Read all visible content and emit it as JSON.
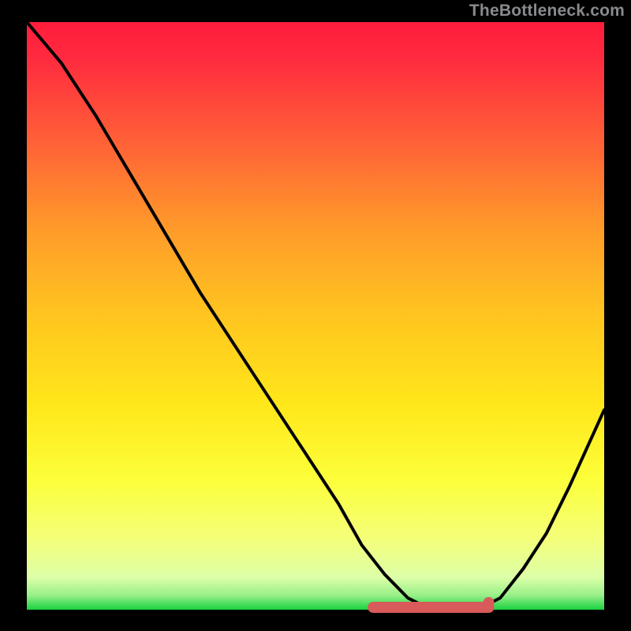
{
  "watermark": "TheBottleneck.com",
  "colors": {
    "background": "#000000",
    "gradient_top": "#ff1c3c",
    "gradient_mid_upper": "#ff8a2b",
    "gradient_mid": "#ffe11a",
    "gradient_lower": "#f9ff6b",
    "gradient_bottom_fade": "#dfffb0",
    "base_green": "#19d340",
    "curve_stroke": "#000000",
    "segment_red": "#d85a5a"
  },
  "chart_data": {
    "type": "line",
    "title": "",
    "xlabel": "",
    "ylabel": "",
    "xlim": [
      0,
      100
    ],
    "ylim": [
      0,
      100
    ],
    "series": [
      {
        "name": "bottleneck-curve",
        "x": [
          0,
          6,
          12,
          18,
          24,
          30,
          36,
          42,
          48,
          54,
          58,
          62,
          66,
          70,
          74,
          78,
          82,
          86,
          90,
          94,
          100
        ],
        "values": [
          100,
          93,
          84,
          74,
          64,
          54,
          45,
          36,
          27,
          18,
          11,
          6,
          2,
          0,
          0,
          0,
          2,
          7,
          13,
          21,
          34
        ]
      }
    ],
    "highlight_segment": {
      "name": "optimal-range",
      "x_start": 60,
      "x_end": 80,
      "y": 0
    }
  }
}
